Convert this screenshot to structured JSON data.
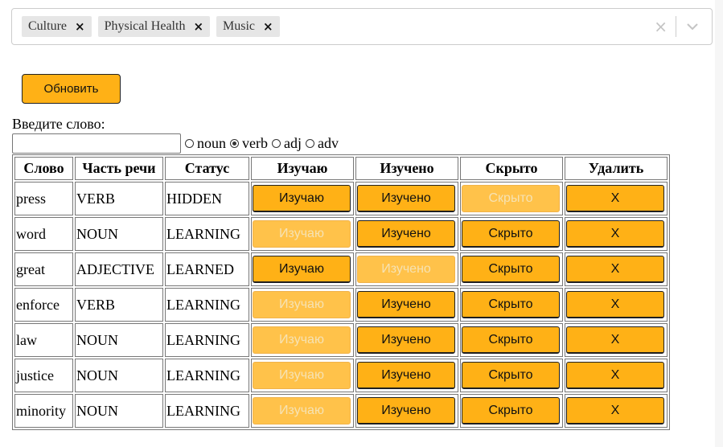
{
  "filter": {
    "chips": [
      {
        "label": "Culture",
        "remove": "×"
      },
      {
        "label": "Physical Health",
        "remove": "×"
      },
      {
        "label": "Music",
        "remove": "×"
      }
    ],
    "clear": "×"
  },
  "update_button": "Обновить",
  "word_input": {
    "label": "Введите слово:",
    "value": ""
  },
  "part_of_speech": {
    "options": [
      {
        "label": "noun",
        "checked": false
      },
      {
        "label": "verb",
        "checked": true
      },
      {
        "label": "adj",
        "checked": false
      },
      {
        "label": "adv",
        "checked": false
      }
    ]
  },
  "table": {
    "headers": [
      "Слово",
      "Часть речи",
      "Статус",
      "Изучаю",
      "Изучено",
      "Скрыто",
      "Удалить"
    ],
    "button_labels": {
      "learning": "Изучаю",
      "learned": "Изучено",
      "hidden": "Скрыто",
      "delete": "X"
    },
    "rows": [
      {
        "word": "press",
        "pos": "VERB",
        "status": "HIDDEN",
        "learning_enabled": true,
        "learned_enabled": true,
        "hidden_enabled": false
      },
      {
        "word": "word",
        "pos": "NOUN",
        "status": "LEARNING",
        "learning_enabled": false,
        "learned_enabled": true,
        "hidden_enabled": true
      },
      {
        "word": "great",
        "pos": "ADJECTIVE",
        "status": "LEARNED",
        "learning_enabled": true,
        "learned_enabled": false,
        "hidden_enabled": true
      },
      {
        "word": "enforce",
        "pos": "VERB",
        "status": "LEARNING",
        "learning_enabled": false,
        "learned_enabled": true,
        "hidden_enabled": true
      },
      {
        "word": "law",
        "pos": "NOUN",
        "status": "LEARNING",
        "learning_enabled": false,
        "learned_enabled": true,
        "hidden_enabled": true
      },
      {
        "word": "justice",
        "pos": "NOUN",
        "status": "LEARNING",
        "learning_enabled": false,
        "learned_enabled": true,
        "hidden_enabled": true
      },
      {
        "word": "minority",
        "pos": "NOUN",
        "status": "LEARNING",
        "learning_enabled": false,
        "learned_enabled": true,
        "hidden_enabled": true
      }
    ]
  },
  "colors": {
    "button_bg": "#ffb116",
    "button_disabled_bg": "#ffc24a",
    "button_disabled_text": "#f6e2b3",
    "chip_bg": "#e6e6e6"
  }
}
